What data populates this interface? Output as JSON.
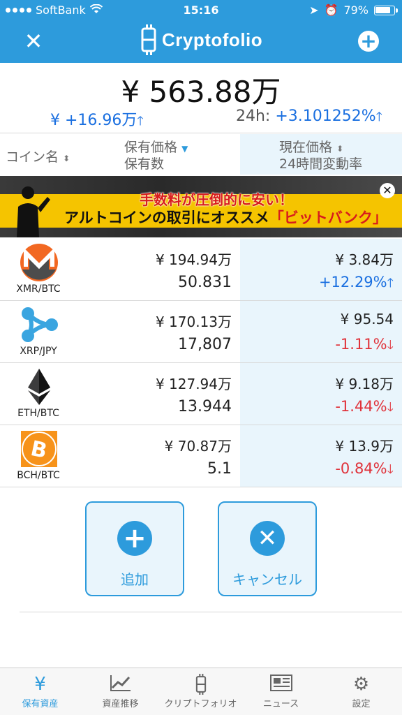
{
  "status": {
    "carrier": "SoftBank",
    "time": "15:16",
    "battery": "79%"
  },
  "header": {
    "app_name": "Cryptofolio",
    "close_icon": "close-icon",
    "add_icon": "plus-icon"
  },
  "summary": {
    "total": "¥ 563.88万",
    "change_amount": "¥ +16.96万",
    "change_label": "24h:",
    "change_pct": "+3.101252%",
    "up_color": "#1a6fe0"
  },
  "columns": {
    "coin": "コイン名",
    "holding_line1": "保有価格",
    "holding_line2": "保有数",
    "price_line1": "現在価格",
    "price_line2": "24時間変動率"
  },
  "ad": {
    "line1": "手数料が圧倒的に安い！",
    "line2_main": "アルトコインの取引にオススメ",
    "line2_brand": "「ビットバンク」"
  },
  "coins": [
    {
      "pair": "XMR/BTC",
      "icon": "monero-icon",
      "value": "¥ 194.94万",
      "qty": "50.831",
      "price": "¥ 3.84万",
      "pct": "+12.29%",
      "dir": "up"
    },
    {
      "pair": "XRP/JPY",
      "icon": "ripple-icon",
      "value": "¥ 170.13万",
      "qty": "17,807",
      "price": "¥ 95.54",
      "pct": "-1.11%",
      "dir": "down"
    },
    {
      "pair": "ETH/BTC",
      "icon": "ethereum-icon",
      "value": "¥ 127.94万",
      "qty": "13.944",
      "price": "¥ 9.18万",
      "pct": "-1.44%",
      "dir": "down"
    },
    {
      "pair": "BCH/BTC",
      "icon": "bitcoin-cash-icon",
      "value": "¥ 70.87万",
      "qty": "5.1",
      "price": "¥ 13.9万",
      "pct": "-0.84%",
      "dir": "down"
    }
  ],
  "actions": {
    "add": "追加",
    "cancel": "キャンセル"
  },
  "tabs": [
    {
      "label": "保有資産",
      "icon": "yen-icon",
      "glyph": "¥"
    },
    {
      "label": "資産推移",
      "icon": "chart-icon",
      "glyph": ""
    },
    {
      "label": "クリプトフォリオ",
      "icon": "cryptofolio-icon",
      "glyph": ""
    },
    {
      "label": "ニュース",
      "icon": "news-icon",
      "glyph": ""
    },
    {
      "label": "設定",
      "icon": "gear-icon",
      "glyph": "⚙"
    }
  ],
  "colors": {
    "accent": "#2d9bdc",
    "down": "#e0323a",
    "shade": "#e9f5fc"
  }
}
